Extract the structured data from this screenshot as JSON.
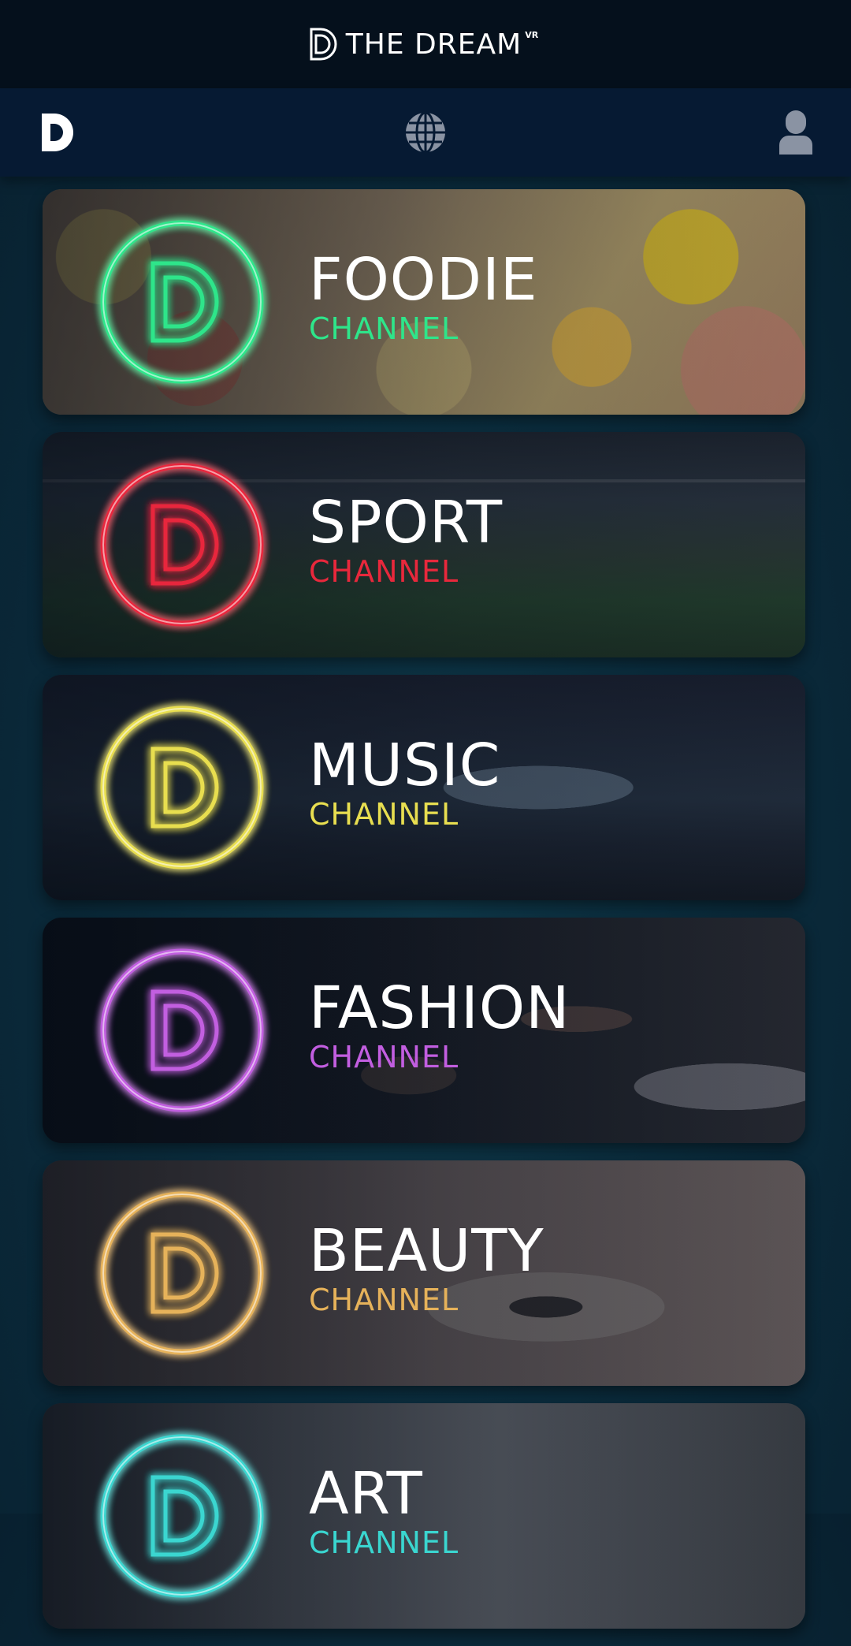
{
  "header": {
    "app_title": "THE DREAM",
    "title_superscript": "VR"
  },
  "nav": {
    "home_icon": "dream-logo-icon",
    "globe_icon": "globe-icon",
    "profile_icon": "user-icon"
  },
  "channels": [
    {
      "title": "FOODIE",
      "subtitle": "CHANNEL",
      "color": "#2ee58a",
      "icon": "dream-logo-icon"
    },
    {
      "title": "SPORT",
      "subtitle": "CHANNEL",
      "color": "#e8283c",
      "icon": "dream-logo-icon"
    },
    {
      "title": "MUSIC",
      "subtitle": "CHANNEL",
      "color": "#e8de50",
      "icon": "dream-logo-icon"
    },
    {
      "title": "FASHION",
      "subtitle": "CHANNEL",
      "color": "#c25ee0",
      "icon": "dream-logo-icon"
    },
    {
      "title": "BEAUTY",
      "subtitle": "CHANNEL",
      "color": "#e6b25a",
      "icon": "dream-logo-icon"
    },
    {
      "title": "ART",
      "subtitle": "CHANNEL",
      "color": "#3ad6d0",
      "icon": "dream-logo-icon"
    }
  ]
}
